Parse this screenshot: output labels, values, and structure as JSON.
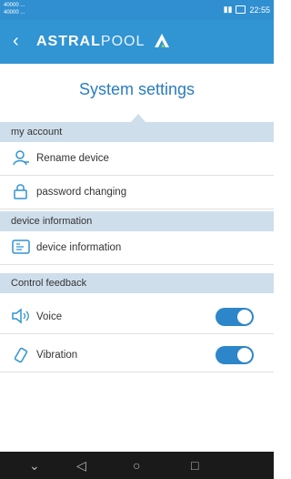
{
  "status_bar": {
    "carrier_line1": "40000 ...",
    "carrier_line2": "40000 ...",
    "time": "22:55"
  },
  "header": {
    "back_glyph": "‹",
    "brand_bold": "ASTRAL",
    "brand_light": "POOL"
  },
  "page_title": "System settings",
  "sections": {
    "account": {
      "title": "my account",
      "items": [
        {
          "label": "Rename device",
          "icon": "user-icon"
        },
        {
          "label": "password changing",
          "icon": "lock-icon"
        }
      ]
    },
    "device": {
      "title": "device information",
      "items": [
        {
          "label": "device information",
          "icon": "device-icon"
        }
      ]
    },
    "feedback": {
      "title": "Control feedback",
      "items": [
        {
          "label": "Voice",
          "icon": "speaker-icon",
          "enabled": true
        },
        {
          "label": "Vibration",
          "icon": "vibration-icon",
          "enabled": true
        }
      ]
    }
  },
  "colors": {
    "accent": "#3194d3",
    "section_bg": "#cfdeeb",
    "title": "#2a7cc0",
    "toggle_on": "#2d86c9"
  }
}
